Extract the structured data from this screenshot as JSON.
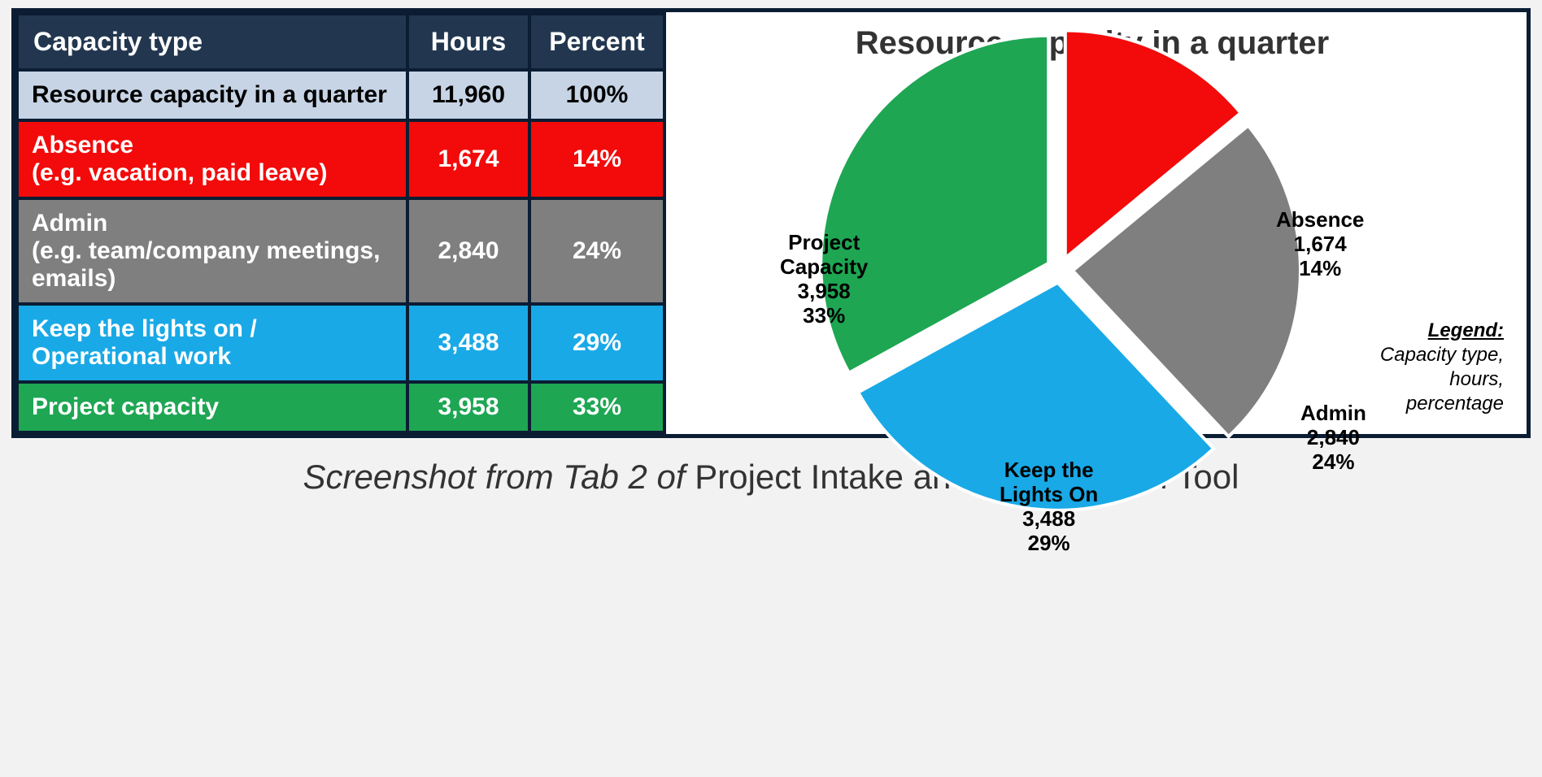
{
  "table": {
    "headers": {
      "type": "Capacity type",
      "hours": "Hours",
      "percent": "Percent"
    },
    "rows": [
      {
        "cls": "total",
        "label": "Resource capacity in a quarter",
        "hours": "11,960",
        "percent": "100%"
      },
      {
        "cls": "absence",
        "label": "Absence\n(e.g. vacation, paid leave)",
        "hours": "1,674",
        "percent": "14%"
      },
      {
        "cls": "admin",
        "label": "Admin\n(e.g. team/company meetings, emails)",
        "hours": "2,840",
        "percent": "24%"
      },
      {
        "cls": "ktlo",
        "label": "Keep the lights on / Operational work",
        "hours": "3,488",
        "percent": "29%"
      },
      {
        "cls": "project",
        "label": "Project capacity",
        "hours": "3,958",
        "percent": "33%"
      }
    ]
  },
  "chart_data": {
    "type": "pie",
    "title": "Resource capacity in a quarter",
    "series": [
      {
        "name": "Absence",
        "hours": 1674,
        "percent": 14,
        "color": "#f30a0a",
        "label": "Absence\n1,674\n14%"
      },
      {
        "name": "Admin",
        "hours": 2840,
        "percent": 24,
        "color": "#7f7f7f",
        "label": "Admin\n2,840\n24%"
      },
      {
        "name": "Keep the Lights On",
        "hours": 3488,
        "percent": 29,
        "color": "#19a9e6",
        "label": "Keep the\nLights On\n3,488\n29%"
      },
      {
        "name": "Project Capacity",
        "hours": 3958,
        "percent": 33,
        "color": "#1ea653",
        "label": "Project\nCapacity\n3,958\n33%"
      }
    ],
    "legend": {
      "title": "Legend:",
      "text": "Capacity type,\nhours,\npercentage"
    }
  },
  "caption": {
    "italic": "Screenshot from Tab 2 of ",
    "plain": "Project Intake and Prioritization Tool"
  }
}
